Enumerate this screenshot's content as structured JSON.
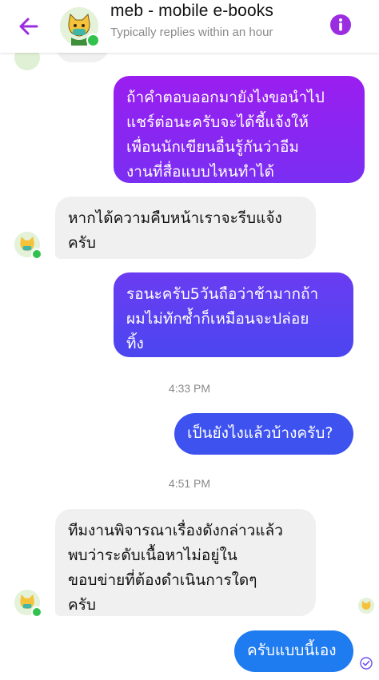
{
  "header": {
    "title": "meb - mobile e-books",
    "subtitle": "Typically replies within an hour",
    "back_icon": "back-arrow-icon",
    "info_icon": "info-icon"
  },
  "colors": {
    "accent": "#9b2de0",
    "bubble_gradient_top": "#9a1ef0",
    "bubble_gradient_bottom": "#2f6cf0",
    "incoming_bubble": "#f0f0f0",
    "online": "#31c24d"
  },
  "messages": [
    {
      "direction": "outgoing",
      "lines": [
        "ถ้าคำตอบออกมายังไงขอนำไป",
        "แชร์ต่อนะครับจะได้ชี้แจ้งให้",
        "เพื่อนนักเขียนอื่นรู้กันว่าอีม",
        "งานที่สื่อแบบไหนทำได้"
      ]
    },
    {
      "direction": "incoming",
      "lines": [
        "หากได้ความคืบหน้าเราจะรีบแจ้ง",
        "ครับ"
      ]
    },
    {
      "direction": "outgoing",
      "lines": [
        "รอนะครับ5วันถือว่าช้ามากถ้า",
        "ผมไม่ทักซ้ำก็เหมือนจะปล่อย",
        "ทิ้ง"
      ]
    },
    {
      "direction": "outgoing",
      "lines": [
        "เป็นยังไงแล้วบ้างครับ?"
      ]
    },
    {
      "direction": "incoming",
      "lines": [
        "ทีมงานพิจารณาเรื่องดังกล่าวแล้ว",
        "พบว่าระดับเนื้อหาไม่อยู่ใน",
        "ขอบข่ายที่ต้องดำเนินการใดๆ",
        "ครับ"
      ]
    },
    {
      "direction": "outgoing",
      "lines": [
        "ครับแบบนี้เอง"
      ]
    }
  ],
  "timestamps": [
    "4:33 PM",
    "4:51 PM"
  ]
}
